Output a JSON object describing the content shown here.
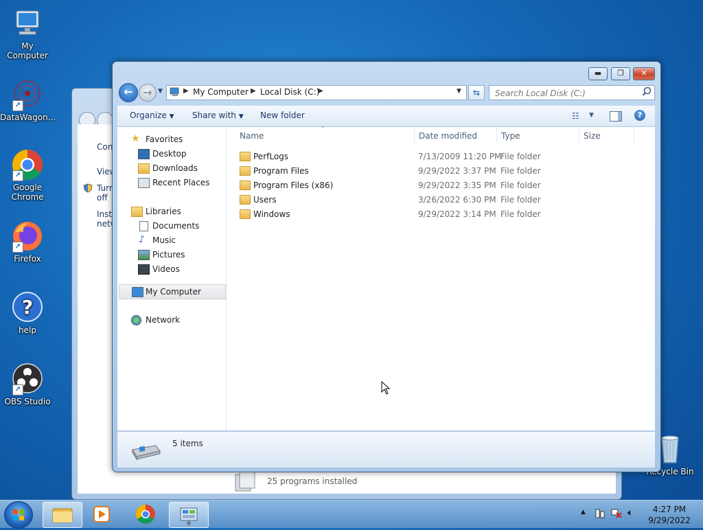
{
  "desktop": {
    "icons": [
      {
        "label": "My Computer"
      },
      {
        "label": "DataWagon..."
      },
      {
        "label": "Google Chrome"
      },
      {
        "label": "Firefox"
      },
      {
        "label": "help"
      },
      {
        "label": "OBS Studio"
      },
      {
        "label": "Recycle Bin"
      }
    ]
  },
  "background_window": {
    "text_items": [
      "Con",
      "View",
      "Turn off",
      "Insta netw"
    ],
    "programs_installed": "25 programs installed"
  },
  "explorer": {
    "address": {
      "crumbs": [
        "My Computer",
        "Local Disk (C:)"
      ]
    },
    "search": {
      "placeholder": "Search Local Disk (C:)"
    },
    "toolbar": {
      "organize": "Organize",
      "share_with": "Share with",
      "new_folder": "New folder"
    },
    "nav": {
      "favorites": "Favorites",
      "desktop": "Desktop",
      "downloads": "Downloads",
      "recent_places": "Recent Places",
      "libraries": "Libraries",
      "documents": "Documents",
      "music": "Music",
      "pictures": "Pictures",
      "videos": "Videos",
      "my_computer": "My Computer",
      "network": "Network"
    },
    "columns": {
      "name": "Name",
      "date": "Date modified",
      "type": "Type",
      "size": "Size"
    },
    "files": [
      {
        "name": "PerfLogs",
        "date": "7/13/2009 11:20 PM",
        "type": "File folder"
      },
      {
        "name": "Program Files",
        "date": "9/29/2022 3:37 PM",
        "type": "File folder"
      },
      {
        "name": "Program Files (x86)",
        "date": "9/29/2022 3:35 PM",
        "type": "File folder"
      },
      {
        "name": "Users",
        "date": "3/26/2022 6:30 PM",
        "type": "File folder"
      },
      {
        "name": "Windows",
        "date": "9/29/2022 3:14 PM",
        "type": "File folder"
      }
    ],
    "status": {
      "item_count": "5 items"
    }
  },
  "taskbar": {
    "clock": {
      "time": "4:27 PM",
      "date": "9/29/2022"
    }
  },
  "colors": {
    "accent": "#1d62b8",
    "folder": "#e9b74b"
  }
}
